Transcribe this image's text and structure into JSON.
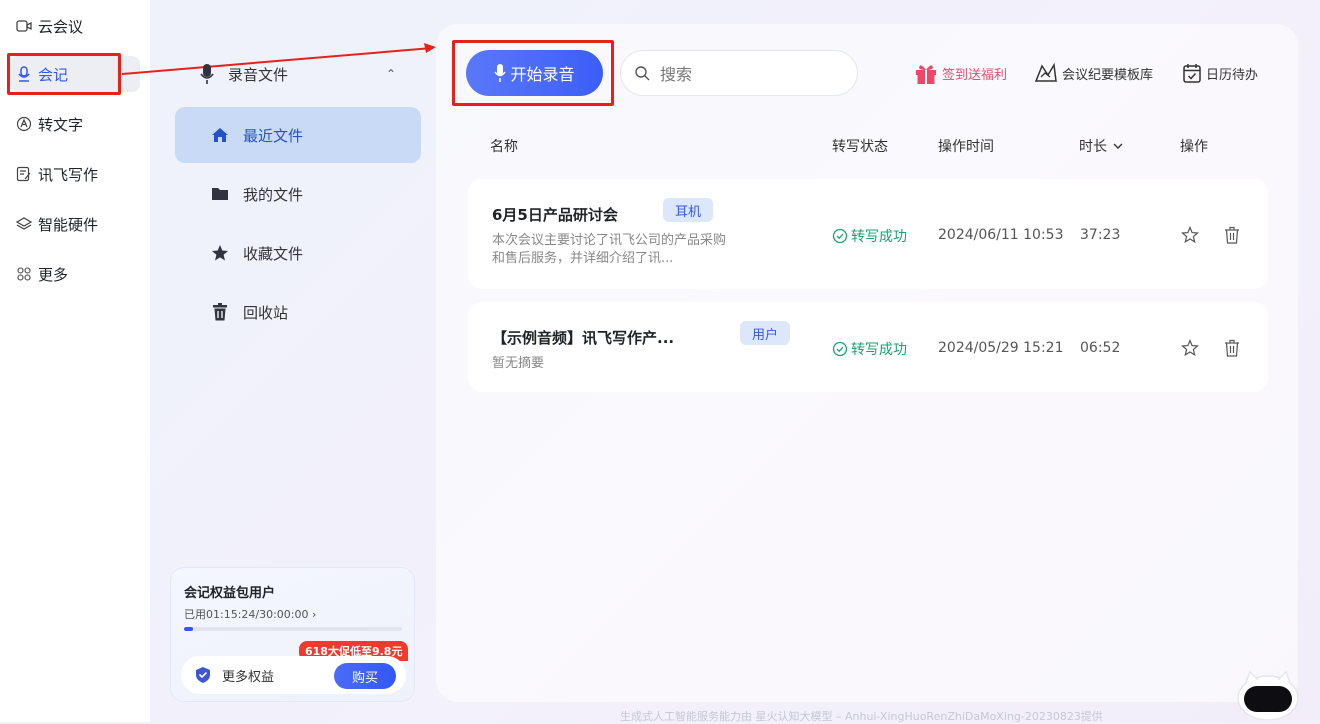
{
  "rail": {
    "items": [
      {
        "label": "云会议",
        "icon": "video-icon"
      },
      {
        "label": "会记",
        "icon": "mic-icon",
        "active": true
      },
      {
        "label": "转文字",
        "icon": "text-icon"
      },
      {
        "label": "讯飞写作",
        "icon": "write-icon"
      },
      {
        "label": "智能硬件",
        "icon": "hardware-icon"
      },
      {
        "label": "更多",
        "icon": "grid-icon"
      }
    ]
  },
  "sidebar": {
    "heading": "录音文件",
    "items": [
      {
        "label": "最近文件",
        "icon": "home-icon",
        "active": true
      },
      {
        "label": "我的文件",
        "icon": "folder-icon"
      },
      {
        "label": "收藏文件",
        "icon": "star-icon"
      },
      {
        "label": "回收站",
        "icon": "trash-icon"
      }
    ],
    "promo": {
      "title": "会记权益包用户",
      "usage": "已用01:15:24/30:00:00 ›",
      "progress": 0.042,
      "tag": "618大促低至9.8元",
      "more": "更多权益",
      "buy": "购买"
    }
  },
  "toolbar": {
    "record_label": "开始录音",
    "search_placeholder": "搜索",
    "signin": "签到送福利",
    "template": "会议纪要模板库",
    "calendar": "日历待办"
  },
  "table": {
    "headers": {
      "name": "名称",
      "status": "转写状态",
      "time": "操作时间",
      "duration": "时长",
      "actions": "操作"
    },
    "rows": [
      {
        "title": "6月5日产品研讨会",
        "badge": "耳机",
        "summary": "本次会议主要讨论了讯飞公司的产品采购和售后服务，并详细介绍了讯...",
        "status": "转写成功",
        "time": "2024/06/11 10:53",
        "duration": "37:23"
      },
      {
        "title": "【示例音频】讯飞写作产...",
        "badge": "用户",
        "summary": "暂无摘要",
        "status": "转写成功",
        "time": "2024/05/29 15:21",
        "duration": "06:52"
      }
    ]
  },
  "footer": "生成式人工智能服务能力由 星火认知大模型 – Anhui-XingHuoRenZhiDaMoXing-20230823提供",
  "colors": {
    "accent": "#3257f6",
    "success": "#1aa36b",
    "annotation": "#e8201a",
    "promo_tag": "#f03a2e"
  }
}
